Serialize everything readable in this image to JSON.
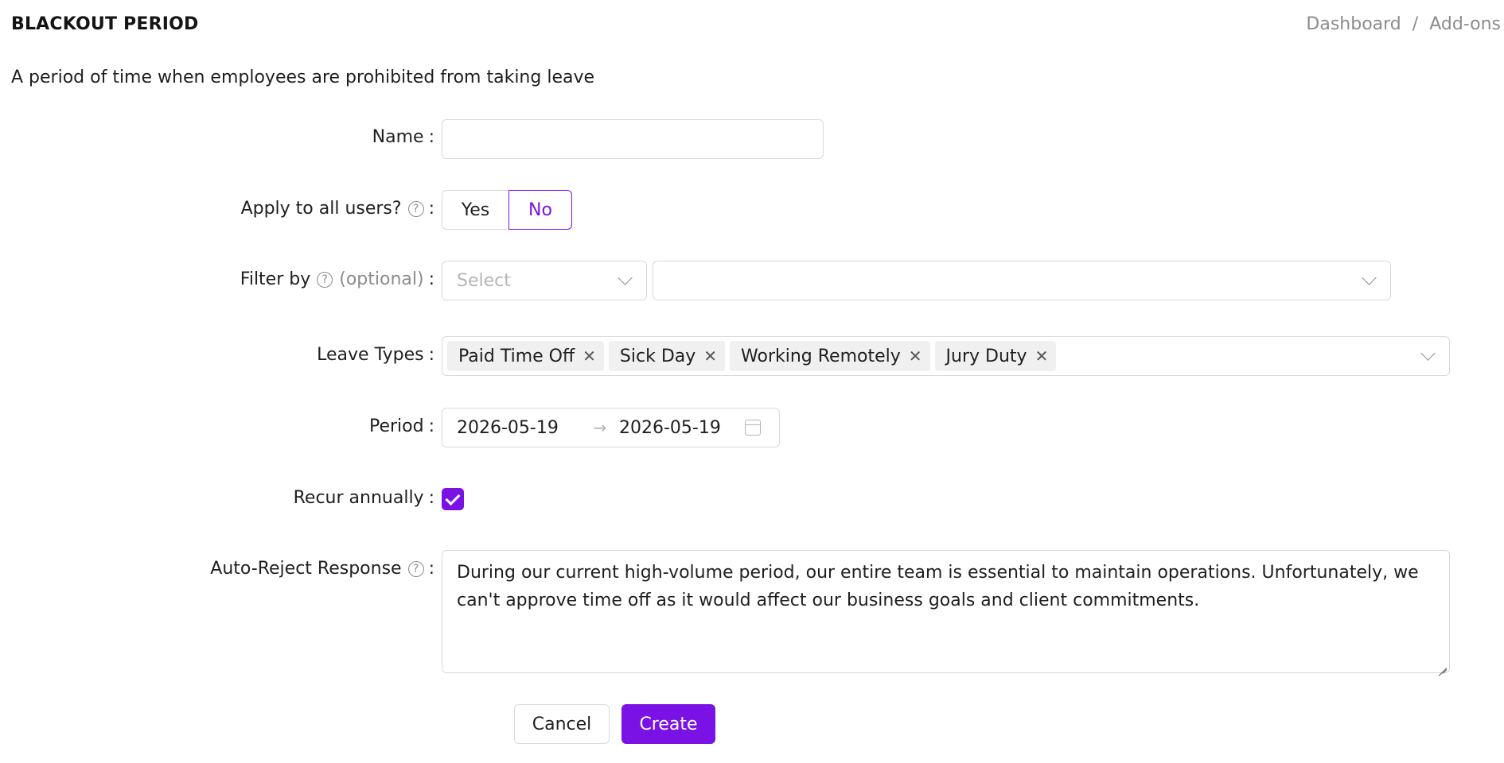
{
  "header": {
    "title": "BLACKOUT PERIOD",
    "breadcrumb": [
      "Dashboard",
      "Add-ons"
    ],
    "separator": "/"
  },
  "description": "A period of time when employees are prohibited from taking leave",
  "form": {
    "name": {
      "label": "Name",
      "value": "",
      "placeholder": ""
    },
    "apply_all": {
      "label": "Apply to all users?",
      "options": [
        "Yes",
        "No"
      ],
      "selected": "No"
    },
    "filter_by": {
      "label": "Filter by",
      "optional": "(optional)",
      "placeholder": "Select",
      "value": ""
    },
    "leave_types": {
      "label": "Leave Types",
      "tags": [
        "Paid Time Off",
        "Sick Day",
        "Working Remotely",
        "Jury Duty"
      ]
    },
    "period": {
      "label": "Period",
      "start": "2026-05-19",
      "end": "2026-05-19",
      "arrow": "→"
    },
    "recur": {
      "label": "Recur annually",
      "checked": true
    },
    "auto_reject": {
      "label": "Auto-Reject Response",
      "value": "During our current high-volume period, our entire team is essential to maintain operations. Unfortunately, we can't approve time off as it would affect our business goals and client commitments."
    },
    "colon": ":",
    "help_glyph": "?"
  },
  "actions": {
    "cancel": "Cancel",
    "create": "Create"
  },
  "colors": {
    "accent": "#7a12e6",
    "border": "#d9d9d9",
    "muted": "#8c8c8c"
  }
}
